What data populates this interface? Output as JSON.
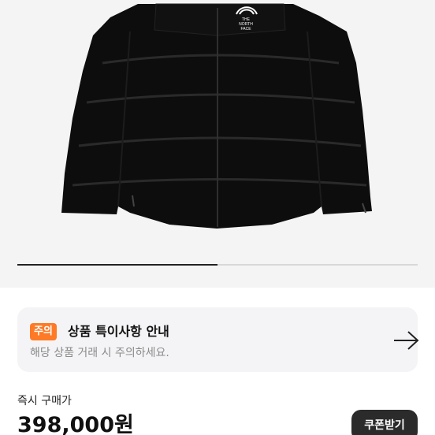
{
  "product_image": {
    "logo_text": "THE NORTH FACE",
    "carousel": {
      "current": 1,
      "total": 2
    }
  },
  "notice": {
    "badge": "주의",
    "title": "상품 특이사항 안내",
    "description": "해당 상품 거래 시 주의하세요.",
    "arrow_icon": "arrow-right-icon"
  },
  "purchase": {
    "label": "즉시 구매가",
    "price": "398,000원",
    "coupon_button": "쿠폰받기"
  },
  "colors": {
    "badge": "#ff7a26",
    "card_background": "#f4f4f6",
    "button": "#2b2b2b",
    "image_background": "#f4f4f4"
  }
}
